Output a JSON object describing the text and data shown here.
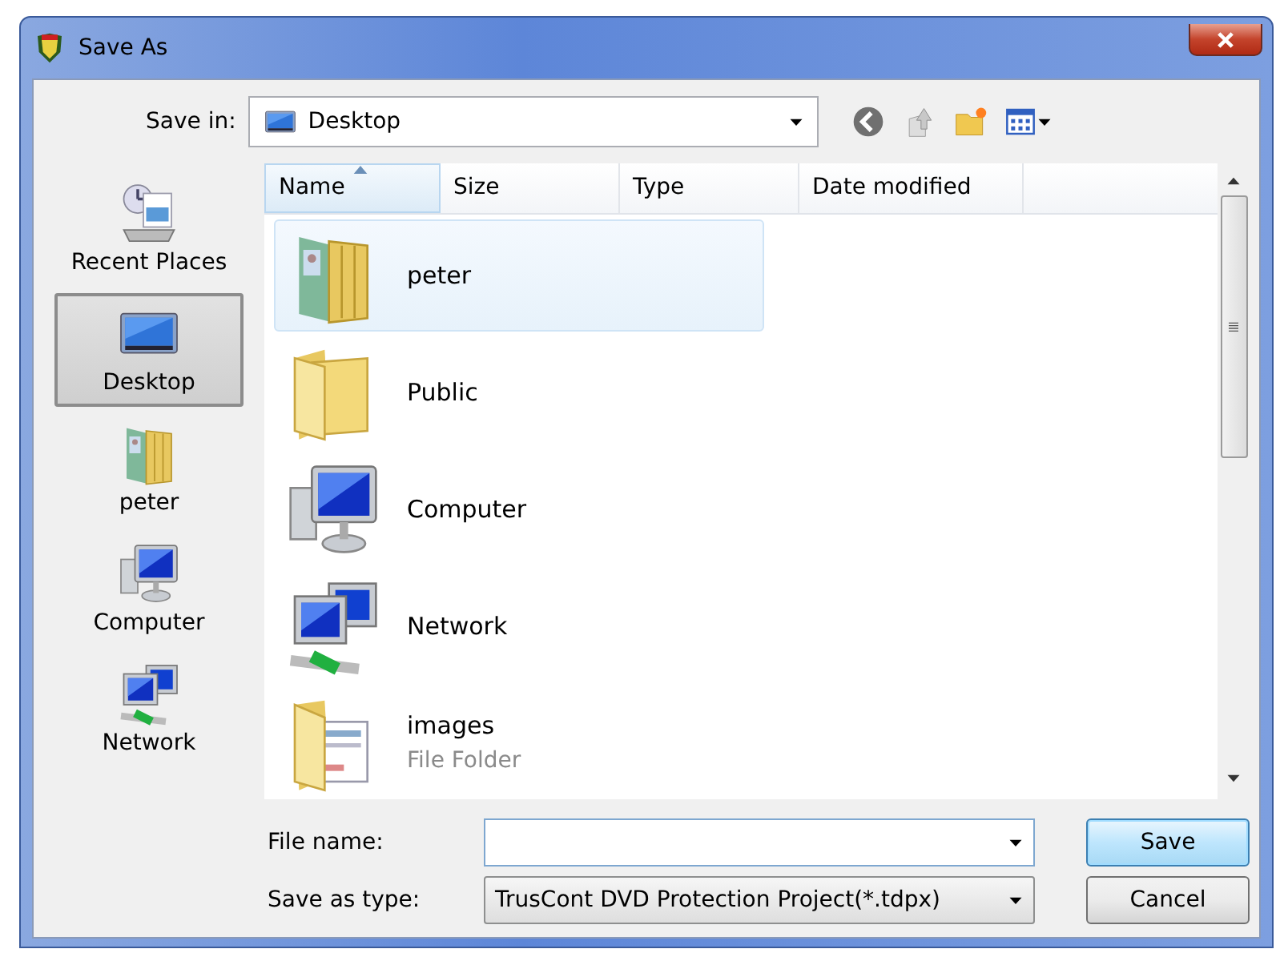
{
  "window": {
    "title": "Save As"
  },
  "save_in": {
    "label": "Save in:",
    "value": "Desktop"
  },
  "sidebar": {
    "items": [
      {
        "label": "Recent Places",
        "kind": "recent",
        "selected": false
      },
      {
        "label": "Desktop",
        "kind": "desktop",
        "selected": true
      },
      {
        "label": "peter",
        "kind": "user",
        "selected": false
      },
      {
        "label": "Computer",
        "kind": "computer",
        "selected": false
      },
      {
        "label": "Network",
        "kind": "network",
        "selected": false
      }
    ]
  },
  "file_list": {
    "columns": [
      {
        "label": "Name",
        "sorted": true
      },
      {
        "label": "Size",
        "sorted": false
      },
      {
        "label": "Type",
        "sorted": false
      },
      {
        "label": "Date modified",
        "sorted": false
      }
    ],
    "items": [
      {
        "name": "peter",
        "kind": "user",
        "selected": true
      },
      {
        "name": "Public",
        "kind": "folder",
        "selected": false
      },
      {
        "name": "Computer",
        "kind": "computer",
        "selected": false
      },
      {
        "name": "Network",
        "kind": "network",
        "selected": false
      },
      {
        "name": "images",
        "detail": "File Folder",
        "kind": "docs",
        "selected": false
      }
    ]
  },
  "file_name": {
    "label": "File name:"
  },
  "save_as_type": {
    "label": "Save as type:",
    "value": "TrusCont DVD Protection Project(*.tdpx)"
  },
  "buttons": [
    {
      "label": "Save",
      "default": true
    },
    {
      "label": "Cancel",
      "default": false
    }
  ]
}
